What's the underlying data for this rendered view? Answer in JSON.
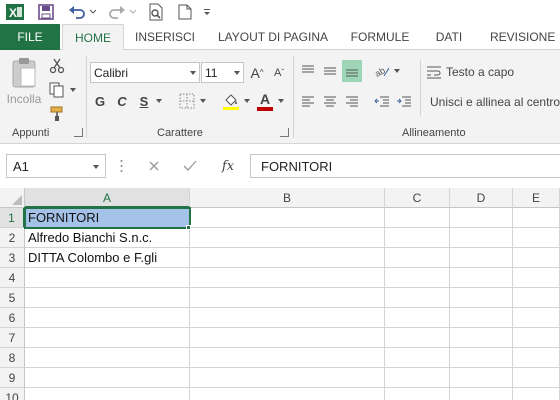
{
  "quick_access": {
    "icons": [
      "excel-icon",
      "save-icon",
      "undo-icon",
      "redo-icon",
      "print-preview-icon",
      "new-document-icon",
      "customize-icon"
    ]
  },
  "tabs": [
    {
      "label": "FILE"
    },
    {
      "label": "HOME"
    },
    {
      "label": "INSERISCI"
    },
    {
      "label": "LAYOUT DI PAGINA"
    },
    {
      "label": "FORMULE"
    },
    {
      "label": "DATI"
    },
    {
      "label": "REVISIONE"
    }
  ],
  "ribbon": {
    "clipboard": {
      "paste_label": "Incolla",
      "group_label": "Appunti"
    },
    "font": {
      "font_name": "Calibri",
      "font_size": "11",
      "bold": "G",
      "italic": "C",
      "underline": "S",
      "grow": "A",
      "shrink": "A",
      "font_color_letter": "A",
      "group_label": "Carattere",
      "font_color": "#c00000",
      "fill_color": "#ffff00"
    },
    "alignment": {
      "wrap_text": "Testo a capo",
      "merge_center": "Unisci e allinea al centro",
      "group_label": "Allineamento"
    }
  },
  "formula_bar": {
    "name_box": "A1",
    "fx": "fx",
    "content": "FORNITORI"
  },
  "grid": {
    "columns": [
      "A",
      "B",
      "C",
      "D",
      "E"
    ],
    "rows": [
      "1",
      "2",
      "3",
      "4",
      "5",
      "6",
      "7",
      "8",
      "9",
      "10"
    ],
    "cells": {
      "A1": "FORNITORI",
      "A2": "Alfredo Bianchi S.n.c.",
      "A3": "DITTA Colombo e F.gli"
    },
    "active_cell": "A1"
  },
  "colors": {
    "accent": "#217346",
    "selection": "#a4c2e8"
  }
}
